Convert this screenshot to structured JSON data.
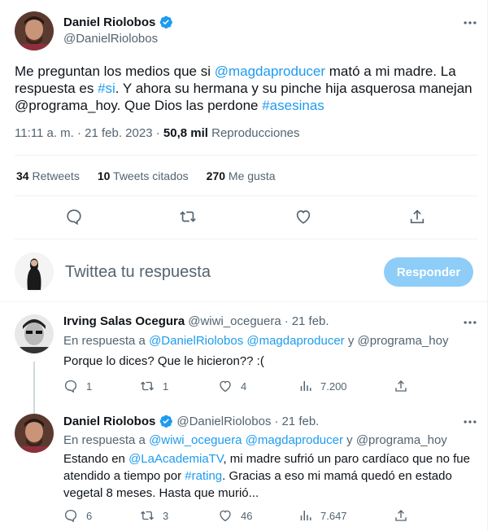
{
  "tweet": {
    "author": "Daniel Riolobos",
    "handle": "@DanielRiolobos",
    "text_parts": [
      {
        "t": "Me preguntan los medios que si ",
        "link": false
      },
      {
        "t": "@magdaproducer",
        "link": true
      },
      {
        "t": " mató a mi madre. La respuesta es ",
        "link": false
      },
      {
        "t": "#si",
        "link": true
      },
      {
        "t": ". Y ahora su hermana y su pinche hija asquerosa manejan @programa_hoy. Que Dios las perdone ",
        "link": false
      },
      {
        "t": "#asesinas",
        "link": true
      }
    ],
    "time": "11:11 a. m. · 21 feb. 2023 · ",
    "views_count": "50,8 mil",
    "views_label": " Reproducciones",
    "retweets_count": "34",
    "retweets_label": " Retweets",
    "quotes_count": "10",
    "quotes_label": " Tweets citados",
    "likes_count": "270",
    "likes_label": " Me gusta",
    "action_icons": [
      "reply-icon",
      "retweet-icon",
      "like-icon",
      "share-icon"
    ]
  },
  "composer": {
    "placeholder": "Twittea tu respuesta",
    "button": "Responder"
  },
  "replies": [
    {
      "name": "Irving Salas Ocegura",
      "handle": "@wiwi_oceguera",
      "date": "21 feb.",
      "in_reply_prefix": "En respuesta a ",
      "in_reply_to_a": "@DanielRiolobos @magdaproducer",
      "in_reply_join": " y @programa_hoy",
      "text": "Porque lo dices? Que le hicieron?? :(",
      "replies": "1",
      "retweets": "1",
      "likes": "4",
      "views": "7.200"
    },
    {
      "name": "Daniel Riolobos",
      "handle": "@DanielRiolobos",
      "date": "21 feb.",
      "in_reply_prefix": "En respuesta a ",
      "in_reply_to_a": "@wiwi_oceguera @magdaproducer",
      "in_reply_join": " y @programa_hoy",
      "text_parts": [
        {
          "t": "Estando en ",
          "link": false
        },
        {
          "t": "@LaAcademiaTV",
          "link": true
        },
        {
          "t": ", mi madre sufrió un paro cardíaco que no fue atendido a tiempo por ",
          "link": false
        },
        {
          "t": "#rating",
          "link": true
        },
        {
          "t": ". Gracias a eso mi mamá quedó en estado vegetal 8 meses. Hasta que murió...",
          "link": false
        }
      ],
      "replies": "6",
      "retweets": "3",
      "likes": "46",
      "views": "7.647"
    }
  ],
  "colors": {
    "link": "#1d9bf0",
    "secondary": "#536471",
    "button": "#8ecdf8"
  }
}
